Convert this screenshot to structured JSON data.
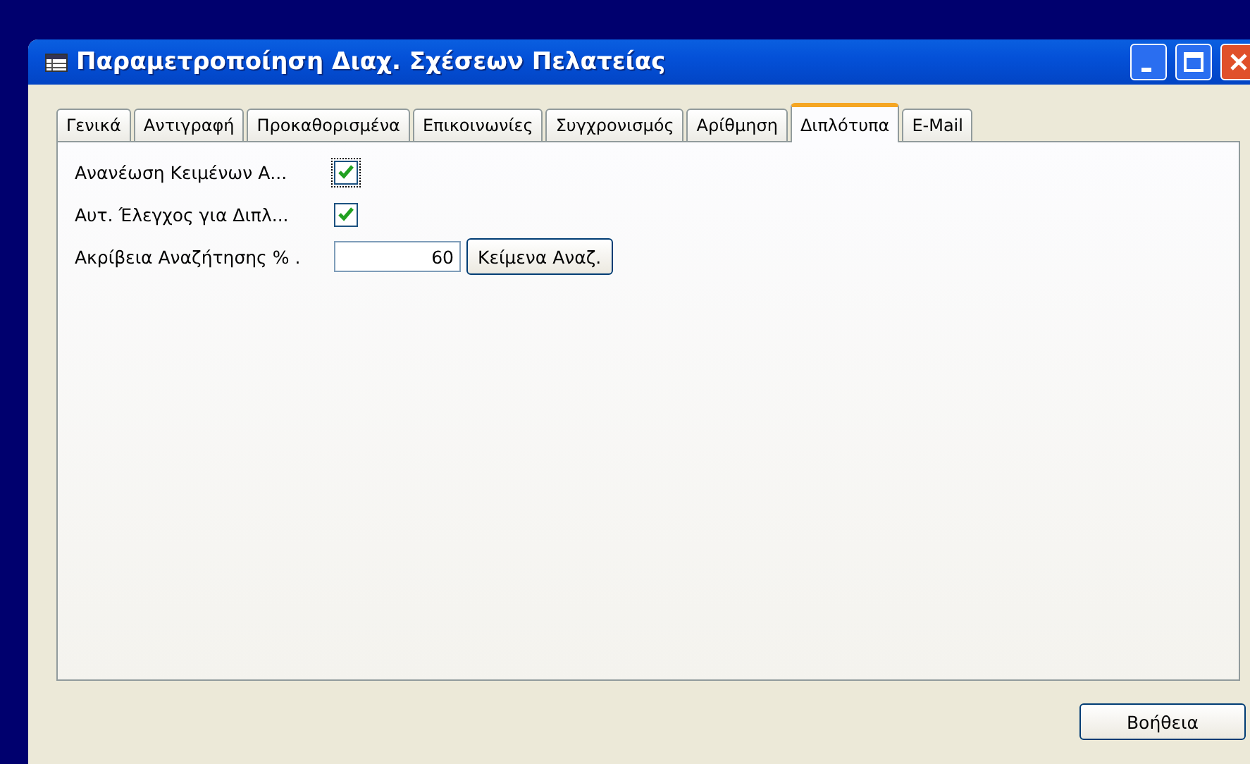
{
  "window": {
    "title": "Παραμετροποίηση Διαχ. Σχέσεων Πελατείας"
  },
  "tabs": [
    {
      "label": "Γενικά",
      "selected": false
    },
    {
      "label": "Αντιγραφή",
      "selected": false
    },
    {
      "label": "Προκαθορισμένα",
      "selected": false
    },
    {
      "label": "Επικοινωνίες",
      "selected": false
    },
    {
      "label": "Συγχρονισμός",
      "selected": false
    },
    {
      "label": "Αρίθμηση",
      "selected": false
    },
    {
      "label": "Διπλότυπα",
      "selected": true
    },
    {
      "label": "E-Mail",
      "selected": false
    }
  ],
  "fields": [
    {
      "kind": "checkbox",
      "label": "Ανανέωση Κειμένων Α...",
      "checked": true,
      "focused": true
    },
    {
      "kind": "checkbox",
      "label": "Αυτ. Έλεγχος για Διπλ...",
      "checked": true,
      "focused": false
    },
    {
      "kind": "number",
      "label": "Ακρίβεια Αναζήτησης % .",
      "value": "60",
      "button": "Κείμενα Αναζ."
    }
  ],
  "buttons": [
    "Βοήθεια"
  ]
}
